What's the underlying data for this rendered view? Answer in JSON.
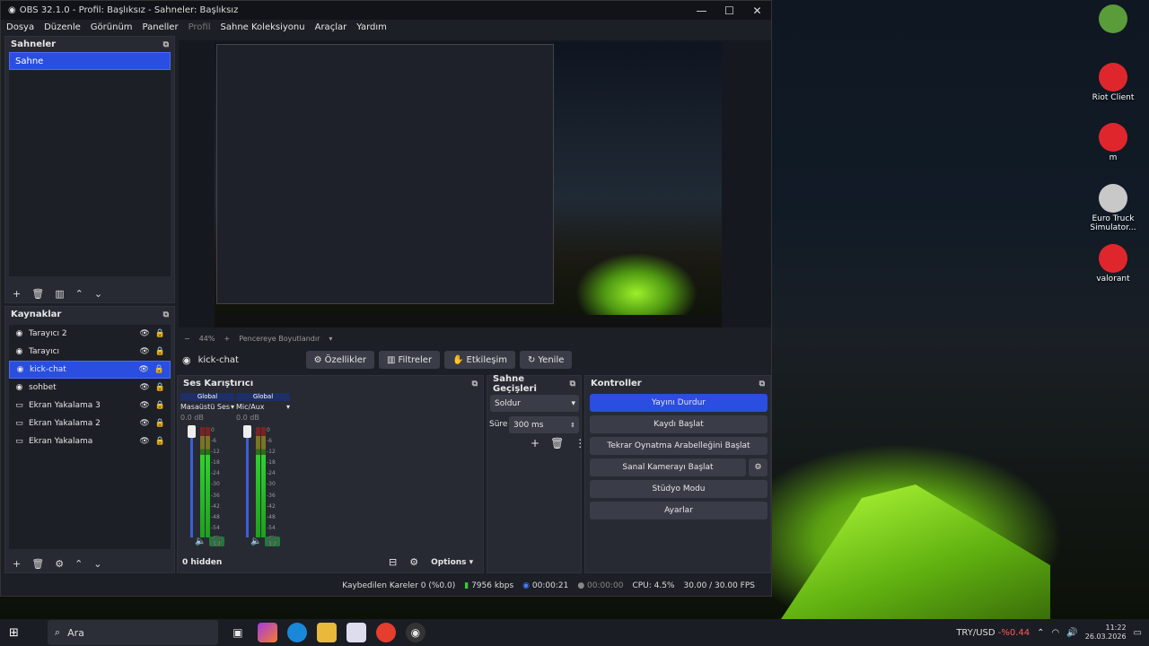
{
  "window": {
    "title": "OBS 32.1.0 - Profil: Başlıksız - Sahneler: Başlıksız"
  },
  "menu": [
    "Dosya",
    "Düzenle",
    "Görünüm",
    "Paneller",
    "Profil",
    "Sahne Koleksiyonu",
    "Araçlar",
    "Yardım"
  ],
  "scenes": {
    "title": "Sahneler",
    "items": [
      "Sahne"
    ]
  },
  "sources": {
    "title": "Kaynaklar",
    "items": [
      {
        "name": "Tarayıcı 2",
        "icon": "globe-icon",
        "selected": false
      },
      {
        "name": "Tarayıcı",
        "icon": "globe-icon",
        "selected": false
      },
      {
        "name": "kick-chat",
        "icon": "globe-icon",
        "selected": true
      },
      {
        "name": "sohbet",
        "icon": "globe-icon",
        "selected": false
      },
      {
        "name": "Ekran Yakalama 3",
        "icon": "monitor-icon",
        "selected": false
      },
      {
        "name": "Ekran Yakalama 2",
        "icon": "monitor-icon",
        "selected": false
      },
      {
        "name": "Ekran Yakalama",
        "icon": "monitor-icon",
        "selected": false
      }
    ]
  },
  "preview": {
    "zoom": "44%",
    "fit_label": "Pencereye Boyutlandır"
  },
  "context": {
    "source": "kick-chat",
    "buttons": [
      "Özellikler",
      "Filtreler",
      "Etkileşim",
      "Yenile"
    ]
  },
  "mixer": {
    "title": "Ses Karıştırıcı",
    "channels": [
      {
        "badge": "Global",
        "name": "Masaüstü Ses",
        "db": "0.0 dB"
      },
      {
        "badge": "Global",
        "name": "Mic/Aux",
        "db": "0.0 dB"
      }
    ],
    "ticks": [
      "0",
      "-6",
      "-12",
      "-18",
      "-24",
      "-30",
      "-36",
      "-42",
      "-48",
      "-54",
      "-60"
    ],
    "hidden": "0 hidden",
    "options": "Options"
  },
  "transitions": {
    "title": "Sahne Geçişleri",
    "selected": "Soldur",
    "duration_label": "Süre",
    "duration": "300 ms"
  },
  "controls": {
    "title": "Kontroller",
    "buttons": [
      "Yayını Durdur",
      "Kaydı Başlat",
      "Tekrar Oynatma Arabelleğini Başlat",
      "Sanal Kamerayı Başlat",
      "Stüdyo Modu",
      "Ayarlar"
    ]
  },
  "status": {
    "dropped": "Kaybedilen Kareler 0 (%0.0)",
    "bitrate": "7956 kbps",
    "stream_time": "00:00:21",
    "rec_time": "00:00:00",
    "cpu": "CPU: 4.5%",
    "fps": "30.00 / 30.00 FPS"
  },
  "desktop_icons": [
    {
      "label": "",
      "color": "#5a9c3a"
    },
    {
      "label": "Riot Client",
      "color": "#e0262d"
    },
    {
      "label": "m",
      "color": "#e0262d"
    },
    {
      "label": "Euro Truck Simulator...",
      "color": "#c8c8c8"
    },
    {
      "label": "valorant",
      "color": "#e0262d"
    }
  ],
  "taskbar": {
    "search": "Ara",
    "currency": "TRY/USD",
    "change": "-%0.44",
    "time": "11:22",
    "date": "26.03.2026"
  },
  "colors": {
    "accent": "#2a4ee0",
    "panel": "#272a33",
    "bg": "#1d1f26"
  }
}
